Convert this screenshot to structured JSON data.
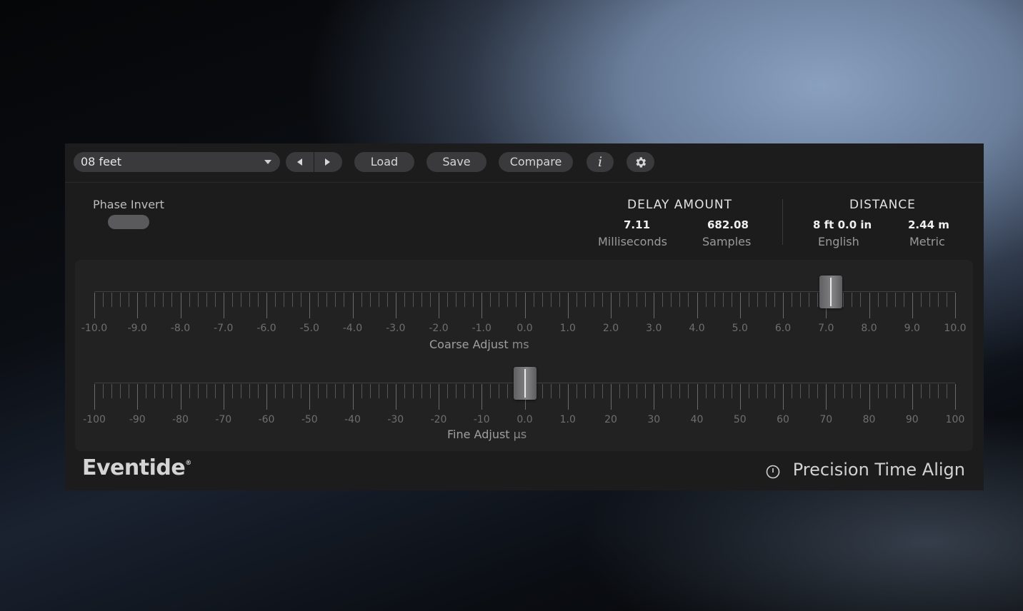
{
  "toolbar": {
    "preset_name": "08 feet",
    "prev_icon": "triangle-left-icon",
    "next_icon": "triangle-right-icon",
    "load_label": "Load",
    "save_label": "Save",
    "compare_label": "Compare",
    "info_label": "i",
    "settings_icon": "gear-icon"
  },
  "phase_invert": {
    "label": "Phase Invert",
    "enabled": false
  },
  "delay_amount": {
    "title": "DELAY AMOUNT",
    "milliseconds_value": "7.11",
    "milliseconds_label": "Milliseconds",
    "samples_value": "682.08",
    "samples_label": "Samples"
  },
  "distance": {
    "title": "DISTANCE",
    "english_value": "8 ft 0.0 in",
    "english_label": "English",
    "metric_value": "2.44 m",
    "metric_label": "Metric"
  },
  "coarse": {
    "label": "Coarse Adjust",
    "unit": "ms",
    "value": 7.11,
    "min": -10,
    "max": 10,
    "tick_labels": [
      "-10.0",
      "-9.0",
      "-8.0",
      "-7.0",
      "-6.0",
      "-5.0",
      "-4.0",
      "-3.0",
      "-2.0",
      "-1.0",
      "0.0",
      "1.0",
      "2.0",
      "3.0",
      "4.0",
      "5.0",
      "6.0",
      "7.0",
      "8.0",
      "9.0",
      "10.0"
    ]
  },
  "fine": {
    "label": "Fine Adjust",
    "unit": "µs",
    "value": 0,
    "min": -100,
    "max": 100,
    "tick_labels": [
      "-100",
      "-90",
      "-80",
      "-70",
      "-60",
      "-50",
      "-40",
      "-30",
      "-20",
      "-10",
      "0.0",
      "1.0",
      "20",
      "30",
      "40",
      "50",
      "60",
      "70",
      "80",
      "90",
      "100"
    ]
  },
  "footer": {
    "brand": "Eventide",
    "brand_mark": "®",
    "product": "Precision Time Align",
    "product_icon": "power-icon"
  }
}
